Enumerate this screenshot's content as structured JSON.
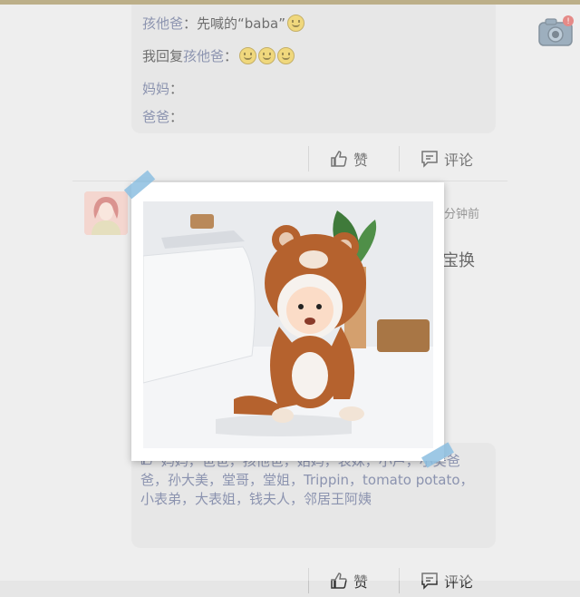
{
  "comments": [
    {
      "who": "孩他爸",
      "text": "：先喊的“baba”",
      "emoji_count": 1
    },
    {
      "prefix": "我回复",
      "who": "孩他爸",
      "text": "：",
      "emoji_count": 3
    },
    {
      "who": "妈妈",
      "text": "："
    },
    {
      "who": "爸爸",
      "text": "："
    }
  ],
  "actions": {
    "like": "赞",
    "comment": "评论"
  },
  "post": {
    "time": "分钟前",
    "text": "宝换"
  },
  "likes": "妈妈，爸爸，孩他爸，姑妈，表妹，小芦，小美爸爸，孙大美，堂哥，堂姐，Trippin，tomato potato，小表弟，大表姐，钱夫人，邻居王阿姨",
  "colors": {
    "name_link": "#55608a",
    "bubble": "#dcdcdc"
  },
  "icons": [
    "thumbs-up-icon",
    "comment-icon",
    "camera-icon",
    "smile-emoji-icon"
  ]
}
